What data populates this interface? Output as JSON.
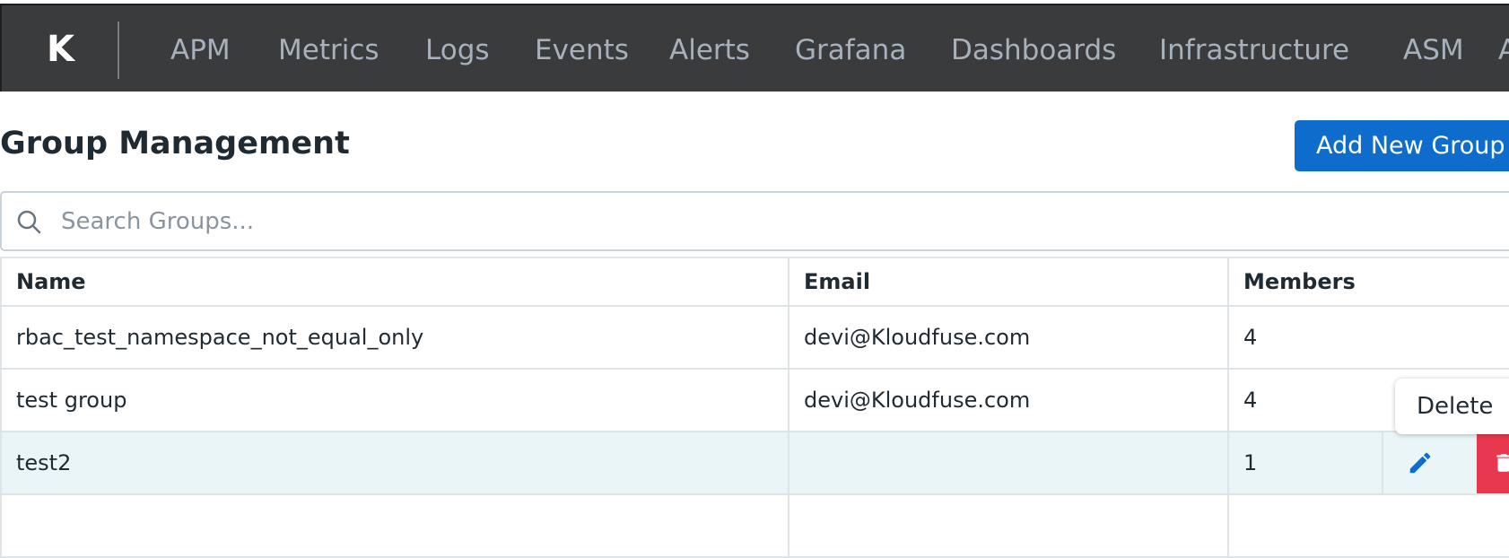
{
  "nav": {
    "logo": "K",
    "items": [
      "APM",
      "Metrics",
      "Logs",
      "Events",
      "Alerts",
      "Grafana",
      "Dashboards",
      "Infrastructure",
      "ASM"
    ],
    "cutoff_item": "A"
  },
  "header": {
    "title": "Group Management",
    "add_button": "Add New Group"
  },
  "search": {
    "placeholder": "Search Groups..."
  },
  "table": {
    "columns": [
      "Name",
      "Email",
      "Members"
    ],
    "rows": [
      {
        "name": "rbac_test_namespace_not_equal_only",
        "email": "devi@Kloudfuse.com",
        "members": "4"
      },
      {
        "name": "test group",
        "email": "devi@Kloudfuse.com",
        "members": "4"
      },
      {
        "name": "test2",
        "email": "",
        "members": "1"
      }
    ]
  },
  "tooltip": {
    "text": "Delete"
  },
  "colors": {
    "nav_bg": "#3a3b3d",
    "nav_text": "#a7b1bb",
    "accent": "#0e6dcc",
    "danger": "#e8384f",
    "highlight_row": "#e9f5f7"
  },
  "icons": {
    "search": "search-icon",
    "edit": "pencil-icon",
    "delete": "trash-icon"
  }
}
